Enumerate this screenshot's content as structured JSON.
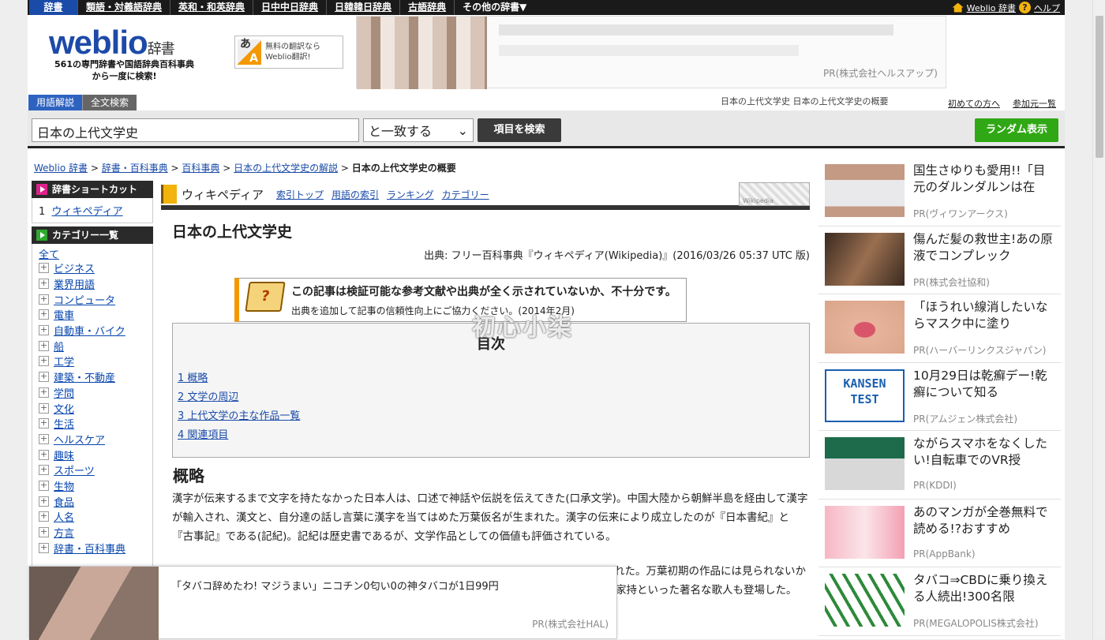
{
  "topbar": {
    "items": [
      "辞書",
      "類語・対義語辞典",
      "英和・和英辞典",
      "日中中日辞典",
      "日韓韓日辞典",
      "古語辞典",
      "その他の辞書▼"
    ],
    "right_site": "Weblio 辞書",
    "help": "ヘルプ"
  },
  "header": {
    "logo": "weblio",
    "logo_suffix": "辞書",
    "subtitle_1": "561の専門辞書や国語辞典百科事典",
    "subtitle_2": "から一度に検索!",
    "translate_1": "無料の翻訳なら",
    "translate_2": "Weblio翻訳!",
    "banner_pr": "PR(株式会社ヘルスアップ)"
  },
  "tabs": [
    "用語解説",
    "全文検索"
  ],
  "top_crumb": "日本の上代文学史 日本の上代文学史の概要",
  "top_links": [
    "初めての方へ",
    "参加元一覧"
  ],
  "search": {
    "value": "日本の上代文学史",
    "mode": "と一致する",
    "button": "項目を検索",
    "random": "ランダム表示"
  },
  "breadcrumb": [
    "Weblio 辞書",
    "辞書・百科事典",
    "百科事典",
    "日本の上代文学史の解説",
    "日本の上代文学史の概要"
  ],
  "sidebar": {
    "shortcut_title": "辞書ショートカット",
    "shortcut_num": "1",
    "shortcut_link": "ウィキペディア",
    "category_title": "カテゴリー一覧",
    "all": "全て",
    "categories": [
      "ビジネス",
      "業界用語",
      "コンピュータ",
      "電車",
      "自動車・バイク",
      "船",
      "工学",
      "建築・不動産",
      "学問",
      "文化",
      "生活",
      "ヘルスケア",
      "趣味",
      "スポーツ",
      "生物",
      "食品",
      "人名",
      "方言",
      "辞書・百科事典"
    ]
  },
  "wiki": {
    "title": "ウィキペディア",
    "links": [
      "索引トップ",
      "用語の索引",
      "ランキング",
      "カテゴリー"
    ],
    "logo_text": "Wikipedia"
  },
  "article": {
    "title": "日本の上代文学史",
    "source": "出典: フリー百科事典『ウィキペディア(Wikipedia)』(2016/03/26 05:37 UTC 版)",
    "notice_1": "この記事は検証可能な参考文献や出典が全く示されていないか、不十分です。",
    "notice_2": "出典を追加して記事の信頼性向上にご協力ください。(2014年2月)",
    "toc_title": "目次",
    "toc": [
      "1 概略",
      "2 文学の周辺",
      "3 上代文学の主な作品一覧",
      "4 関連項目"
    ],
    "h2": "概略",
    "para": "漢字が伝来するまで文字を持たなかった日本人は、口述で神話や伝説を伝えてきた(口承文学)。中国大陸から朝鮮半島を経由して漢字が輸入され、漢文と、自分達の話し言葉に漢字を当てはめた万葉仮名が生まれた。漢字の伝来により成立したのが『日本書紀』と『古事記』である(記紀)。記紀は歴史書であるが、文学作品としての価値も評価されている。",
    "para2_a": "れた。万葉初期の作品には見られないか",
    "para2_b": "家持といった著名な歌人も登場した。",
    "watermark": "初心小柒"
  },
  "bottom_ad": {
    "text": "「タバコ辞めたわ! マジうまい」ニコチン0匂い0の神タバコが1日99円",
    "pr": "PR(株式会社HAL)"
  },
  "right_ads": [
    {
      "text": "国生さゆりも愛用!!「目元のダルンダルンは在",
      "pr": "PR(ヴィワンアークス)"
    },
    {
      "text": "傷んだ髪の救世主!あの原液でコンプレック",
      "pr": "PR(株式会社協和)"
    },
    {
      "text": "「ほうれい線消したいならマスク中に塗り",
      "pr": "PR(ハーバーリンクスジャパン)"
    },
    {
      "text": "10月29日は乾癬デー!乾癬について知る",
      "pr": "PR(アムジェン株式会社)"
    },
    {
      "text": "ながらスマホをなくしたい!自転車でのVR授",
      "pr": "PR(KDDI)"
    },
    {
      "text": "あのマンガが全巻無料で読める!?おすすめ",
      "pr": "PR(AppBank)"
    },
    {
      "text": "タバコ⇒CBDに乗り換える人続出!300名限",
      "pr": "PR(MEGALOPOLIS株式会社)"
    }
  ],
  "ad_info": "i",
  "colors": {
    "brand": "#1d4aa8",
    "accent": "#f39800",
    "random_btn": "#30a815"
  }
}
